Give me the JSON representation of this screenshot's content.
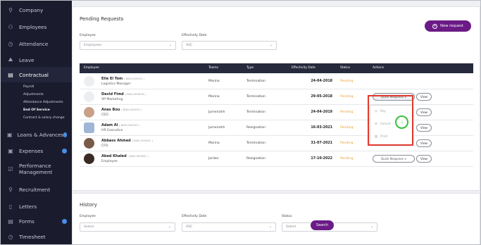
{
  "sidebar": {
    "items": [
      {
        "label": "Company",
        "icon": "company-icon"
      },
      {
        "label": "Employees",
        "icon": "employees-icon"
      },
      {
        "label": "Attendance",
        "icon": "clock-icon"
      },
      {
        "label": "Leave",
        "icon": "leave-icon"
      },
      {
        "label": "Contractual",
        "icon": "contract-icon"
      },
      {
        "label": "Loans & Advances",
        "icon": "loans-icon"
      },
      {
        "label": "Expenses",
        "icon": "expenses-icon"
      },
      {
        "label": "Performance",
        "label2": "Management",
        "icon": "performance-icon"
      },
      {
        "label": "Recruitment",
        "icon": "recruitment-icon"
      },
      {
        "label": "Letters",
        "icon": "letters-icon"
      },
      {
        "label": "Forms",
        "icon": "forms-icon"
      },
      {
        "label": "Timesheet",
        "icon": "timesheet-icon"
      }
    ],
    "contractual_sub": [
      "Payroll",
      "Adjustments",
      "Attendance Adjustments",
      "End Of Service",
      "Contract & salary change"
    ]
  },
  "pending": {
    "title": "Pending Requests",
    "new_button": "New request",
    "filter_employee_label": "Employee",
    "filter_employee_value": "Employees",
    "filter_date_label": "Effectivity Date",
    "filter_date_value": "ASC",
    "columns": [
      "Employee",
      "Teams",
      "Type",
      "Effectivity Date",
      "Status",
      "Actions"
    ],
    "rows": [
      {
        "name": "Elie El Tom",
        "code": "( BAD-000001 )",
        "position": "Logistics Manager",
        "team": "Marina",
        "type": "Termination",
        "date": "24-04-2018",
        "status": "Pending"
      },
      {
        "name": "David Fimd",
        "code": "( BAD-000006 )",
        "position": "VP Marketing",
        "team": "Marina",
        "type": "Termination",
        "date": "29-05-2018",
        "status": "Pending"
      },
      {
        "name": "Anas Bou",
        "code": "( BAD-000032 )",
        "position": "CEO",
        "team": "Jumeirahh",
        "type": "Termination",
        "date": "24-04-2019",
        "status": "Pending"
      },
      {
        "name": "Adam Al",
        "code": "( BAD-000052 )",
        "position": "HR Executive",
        "team": "Jumeirahh",
        "type": "Resignation",
        "date": "16-03-2021",
        "status": "Pending"
      },
      {
        "name": "Abbass Ahmed",
        "code": "( BAD-000061 )",
        "position": "CFO",
        "team": "Marina",
        "type": "Termination",
        "date": "31-07-2021",
        "status": "Pending"
      },
      {
        "name": "Abed Khaled",
        "code": "( BAD-000081 )",
        "position": "Employee",
        "team": "Jordan",
        "type": "Resignation",
        "date": "17-10-2022",
        "status": "Pending"
      }
    ],
    "quick_response": "Quick Response ∨",
    "view": "View",
    "dropdown": [
      "Pay",
      "Cancel",
      "Print"
    ]
  },
  "history": {
    "title": "History",
    "employee_label": "Employee",
    "employee_value": "Select",
    "date_label": "Effectivity Date",
    "date_value": "ASC",
    "status_label": "Status",
    "status_value": "Select",
    "search": "Search"
  },
  "colors": {
    "accent": "#6a1b86",
    "sidebar": "#1a1c2e",
    "pending": "#e8a330",
    "highlight": "#e03a2e",
    "cursor": "#37c03c"
  }
}
